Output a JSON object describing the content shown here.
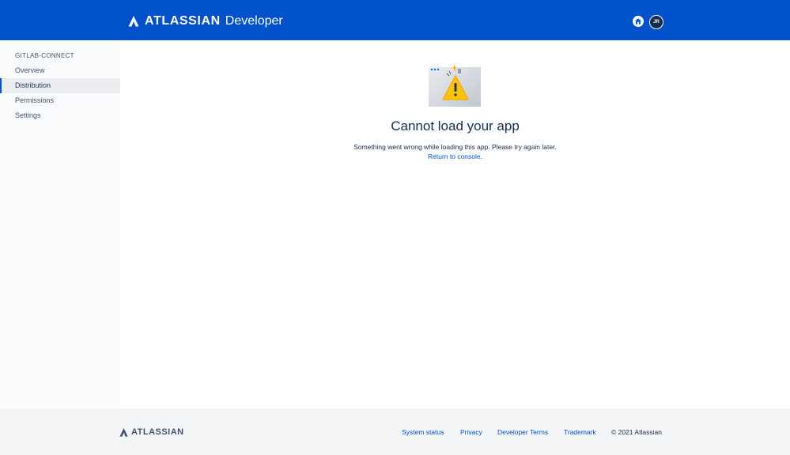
{
  "header": {
    "brand_name": "ATLASSIAN",
    "product_name": "Developer",
    "avatar_initials": "JR",
    "home_icon": "home-icon",
    "bg_color": "#0052CC"
  },
  "sidebar": {
    "heading": "GITLAB-CONNECT",
    "items": [
      {
        "label": "Overview",
        "active": false
      },
      {
        "label": "Distribution",
        "active": true
      },
      {
        "label": "Permissions",
        "active": false
      },
      {
        "label": "Settings",
        "active": false
      }
    ]
  },
  "main": {
    "illustration_icon": "warning-illustration-icon",
    "title": "Cannot load your app",
    "message": "Something went wrong while loading this app. Please try again later.",
    "link_text": "Return to console",
    "link_suffix": "."
  },
  "footer": {
    "brand_name": "ATLASSIAN",
    "links": [
      "System status",
      "Privacy",
      "Developer Terms",
      "Trademark"
    ],
    "copyright": "© 2021 Atlassian"
  }
}
